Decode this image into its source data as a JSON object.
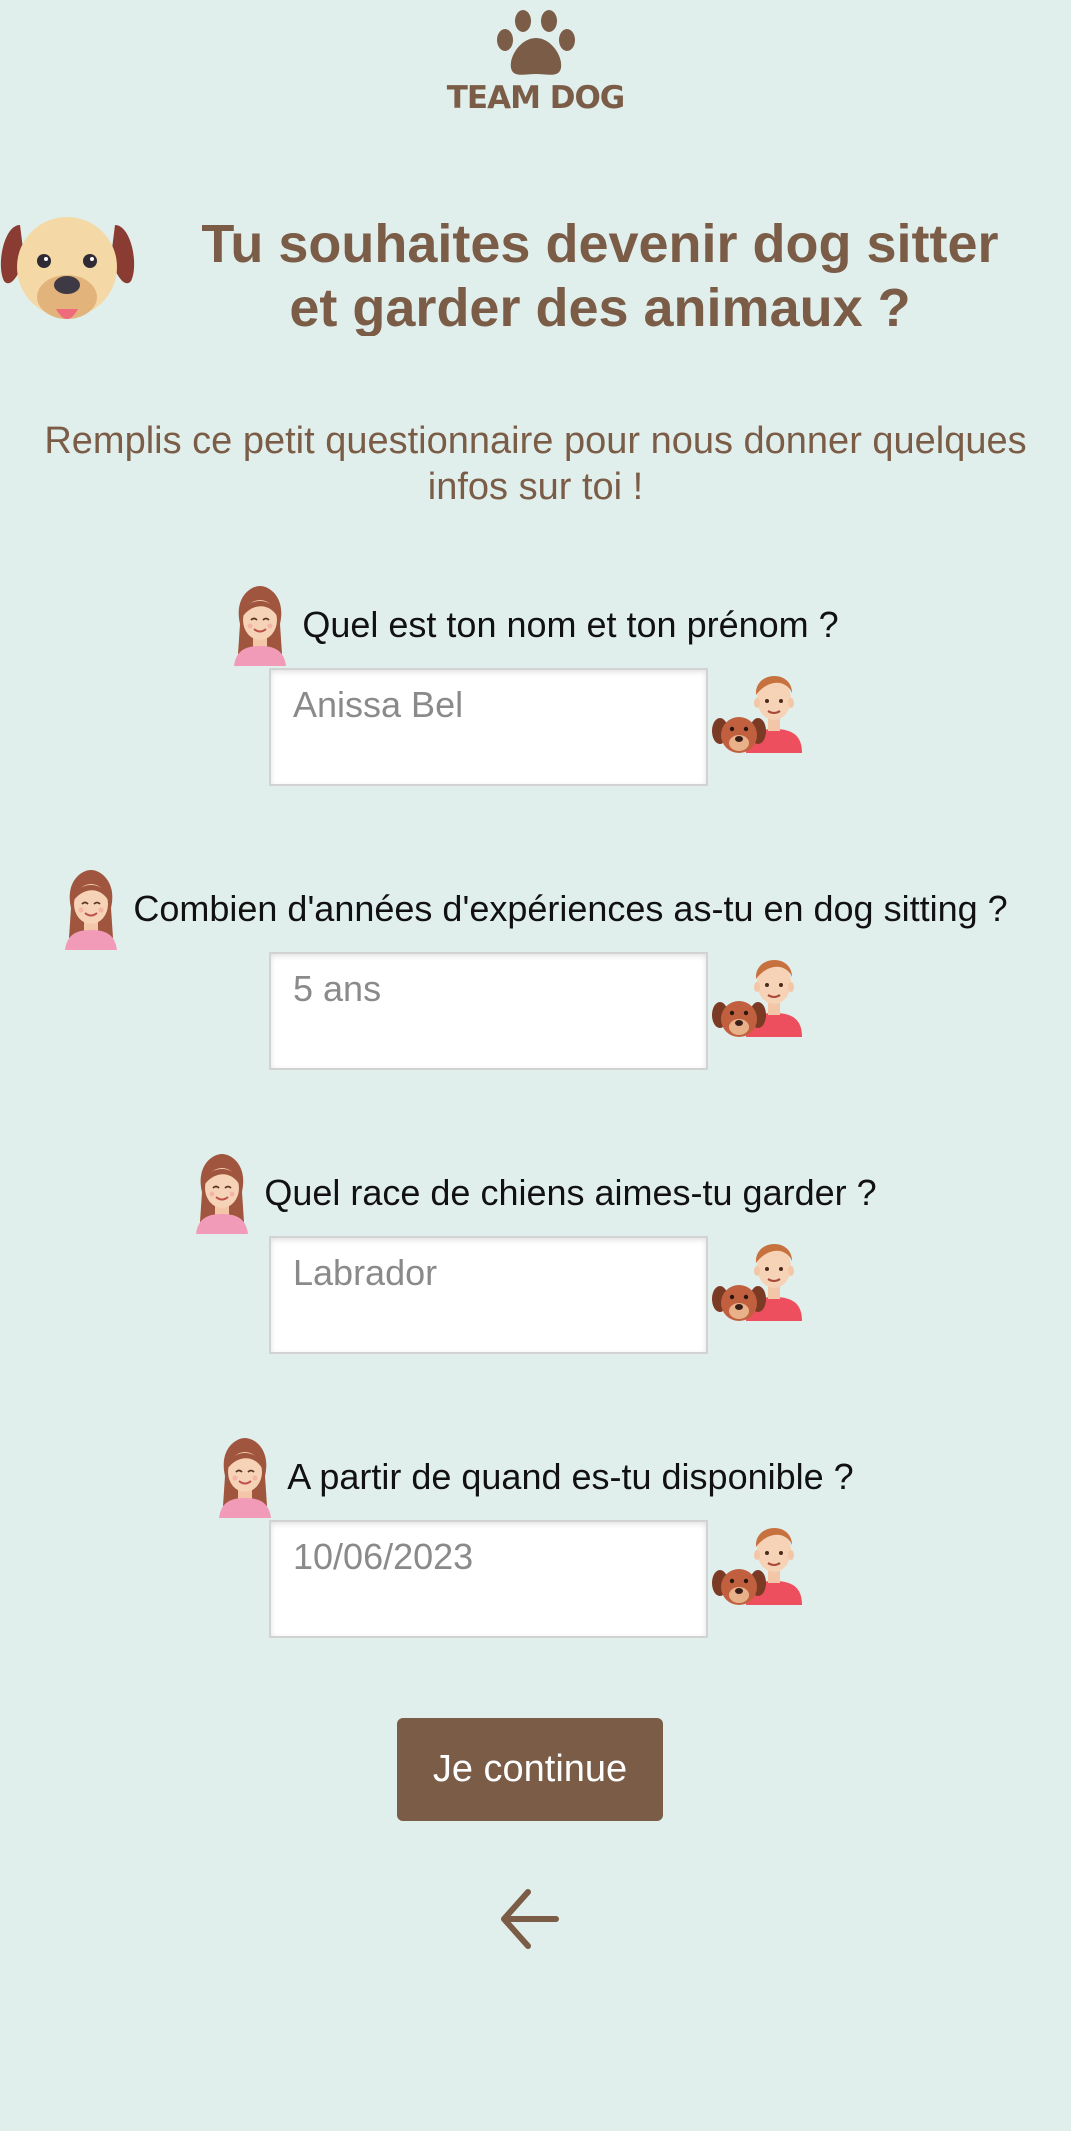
{
  "app": {
    "logo_text": "TEAM DOG"
  },
  "header": {
    "title": "Tu souhaites devenir dog sitter et garder des animaux ?",
    "subtitle": "Remplis ce petit questionnaire pour nous donner quelques infos sur toi !"
  },
  "questions": [
    {
      "label": "Quel est ton nom et ton prénom ?",
      "value": "",
      "placeholder": "Anissa Bel"
    },
    {
      "label": "Combien d'années d'expériences as-tu en dog sitting ?",
      "value": "",
      "placeholder": "5 ans"
    },
    {
      "label": "Quel race de chiens aimes-tu garder ?",
      "value": "",
      "placeholder": "Labrador"
    },
    {
      "label": "A partir de quand es-tu disponible ?",
      "value": "",
      "placeholder": "10/06/2023"
    }
  ],
  "actions": {
    "continue_label": "Je continue",
    "back_icon": "arrow-left-icon"
  },
  "colors": {
    "background": "#e1efec",
    "brand_brown": "#7a5c47",
    "text_dark": "#111111",
    "field_text": "#8a8a8a"
  }
}
